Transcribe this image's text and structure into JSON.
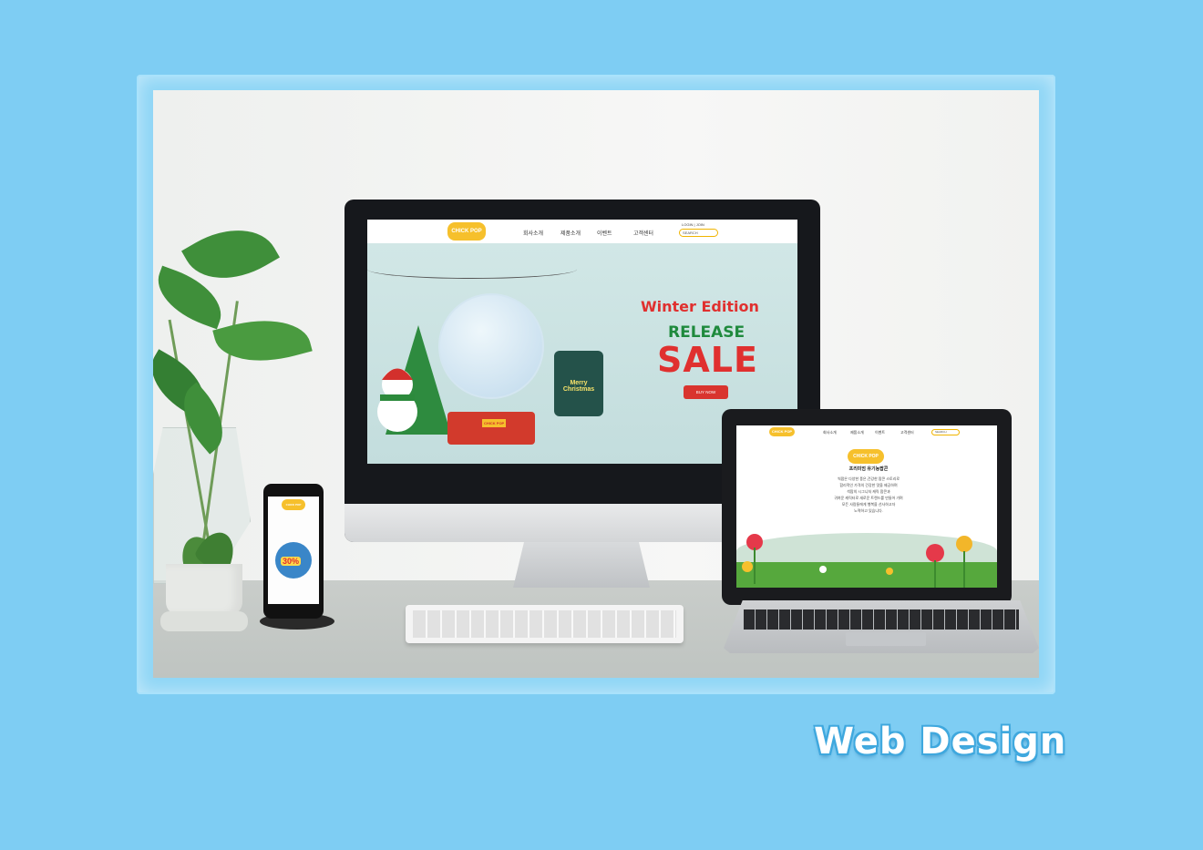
{
  "caption": {
    "title": "Web Design"
  },
  "desktop_site": {
    "logo": "CHICK POP",
    "nav": [
      "회사소개",
      "제품소개",
      "이벤트",
      "고객센터"
    ],
    "login_join": "LOGIN | JOIN",
    "search_placeholder": "SEARCH",
    "hero": {
      "headline": "Winter Edition",
      "subheadline": "RELEASE",
      "sale": "SALE",
      "button": "BUY NOW",
      "tin_label": "Merry Christmas",
      "globe_label": "CHICK POP"
    }
  },
  "laptop_site": {
    "logo": "CHICK POP",
    "nav": [
      "회사소개",
      "제품소개",
      "이벤트",
      "고객센터"
    ],
    "search_placeholder": "SEARCH",
    "heading": "프리미엄 유기농팝콘",
    "body_lines": [
      "씩팝은 다양한 풍은,건강한 팝콘 스토리로",
      "합리적인 가격의 건강한 맛을 제공하며",
      "씩팝의 시그니처 캐릭 팝콘과",
      "귀여운 캐릭터로 새로운 트렌드를 만들어 가며",
      "모든 사람들에게 행복을 선사하고자",
      "노력하고 있습니다."
    ]
  },
  "phone_site": {
    "logo": "CHICK POP",
    "badge": "30%"
  },
  "colors": {
    "background": "#7ecdf3",
    "brand_red": "#e0302f",
    "brand_green": "#1f8a3d",
    "brand_yellow": "#f6c02c"
  }
}
